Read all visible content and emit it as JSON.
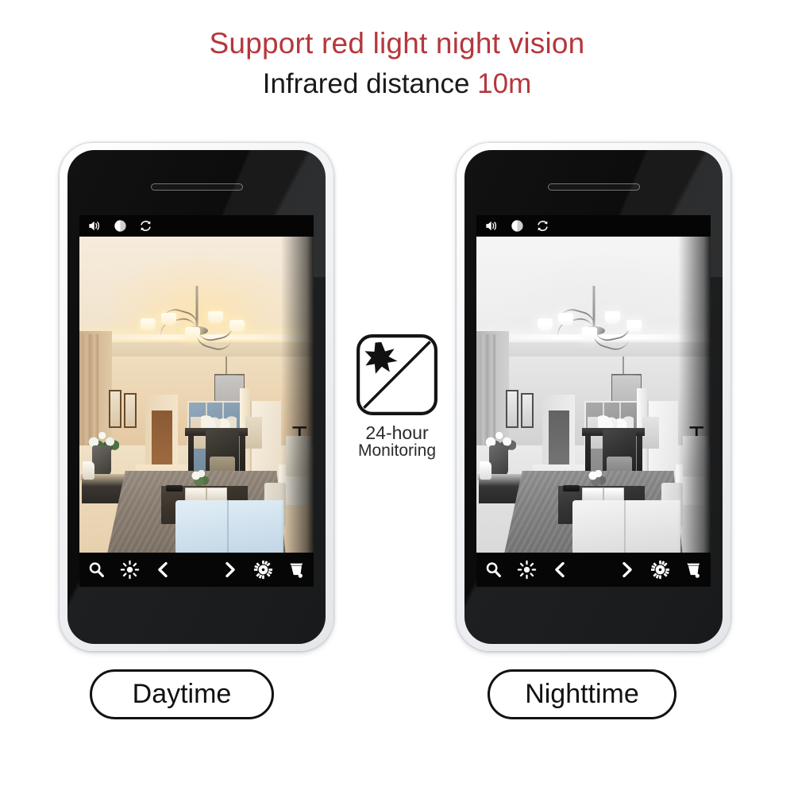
{
  "page": {
    "background_color": "#ffffff",
    "accent_red": "#b5373c",
    "text_dark": "#1a1a1a"
  },
  "headline": {
    "line1": "Support red light night vision",
    "line2_prefix": "Infrared distance ",
    "line2_accent": "10m"
  },
  "badge": {
    "name": "24-hour-monitoring-badge",
    "caption_line1": "24-hour",
    "caption_line2": "Monitoring",
    "sun_icon": "sun-star-icon",
    "moon_icon": "crescent-moon-icon",
    "divider_icon": "diagonal-divider"
  },
  "phones": [
    {
      "id": "daytime",
      "label": "Daytime",
      "mode": "color",
      "top_bar_icons": [
        "volume-speaker-icon",
        "contrast-half-circle-icon",
        "rotate-refresh-icon"
      ],
      "bottom_bar_icons": [
        "zoom-magnifier-icon",
        "brightness-sun-icon",
        "chevron-left-icon",
        "chevron-right-icon",
        "settings-gear-icon",
        "trash-bin-icon"
      ]
    },
    {
      "id": "nighttime",
      "label": "Nighttime",
      "mode": "grayscale",
      "top_bar_icons": [
        "volume-speaker-icon",
        "contrast-half-circle-icon",
        "rotate-refresh-icon"
      ],
      "bottom_bar_icons": [
        "zoom-magnifier-icon",
        "brightness-sun-icon",
        "chevron-left-icon",
        "chevron-right-icon",
        "settings-gear-icon",
        "trash-bin-icon"
      ]
    }
  ],
  "scene": {
    "description": "Living room interior with chandelier, cove lighting, coffee table, rug and ottoman",
    "daytime_tint": "#e8d7bc",
    "nighttime_tint": "#b8b8b8"
  }
}
